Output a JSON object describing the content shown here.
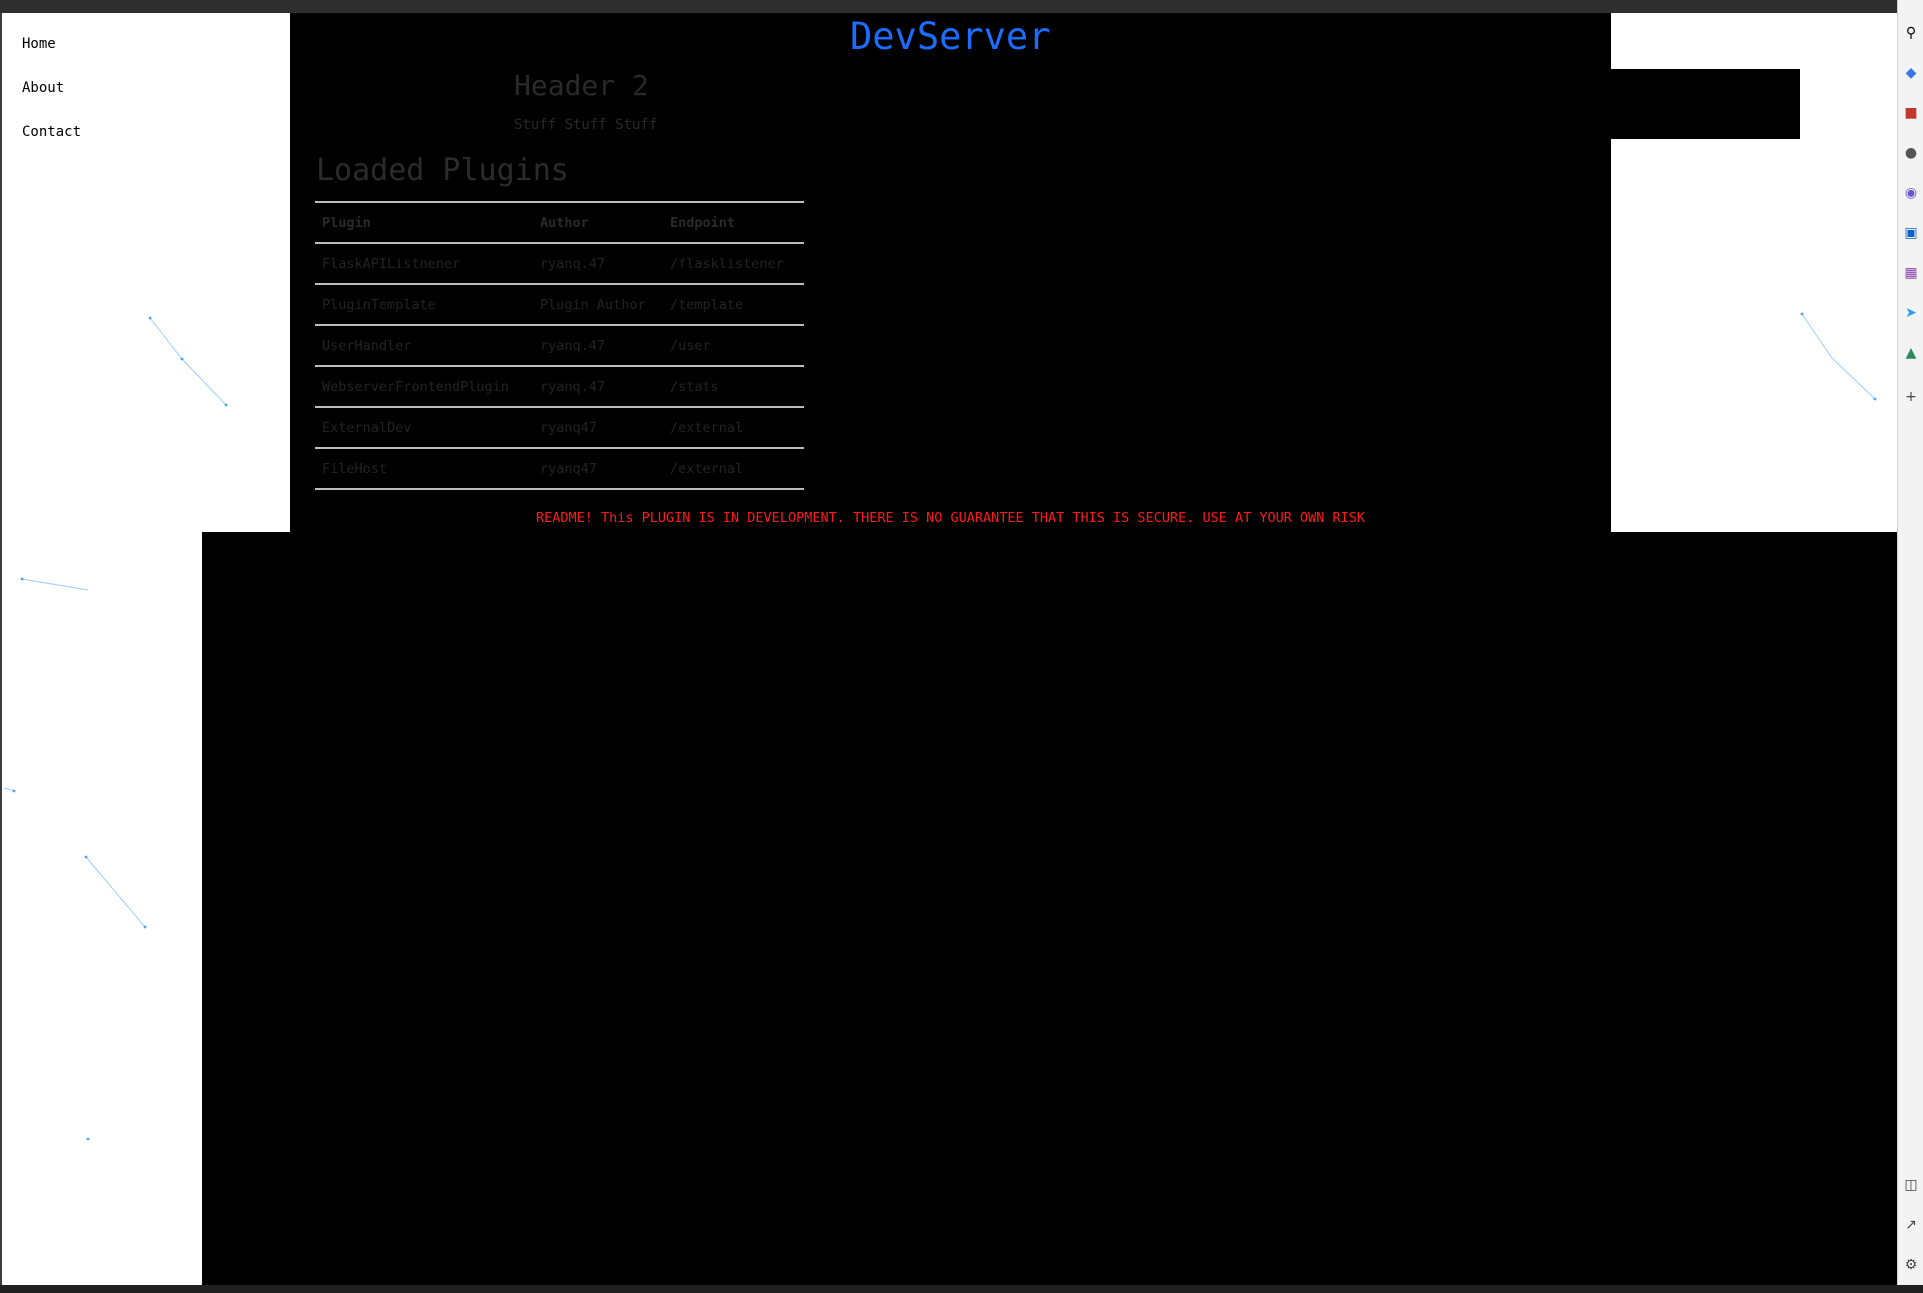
{
  "site": {
    "title": "DevServer",
    "title_color": "#1a6dff",
    "readme_color": "#ff1a1a",
    "particle_color": "#1e90ff"
  },
  "nav": {
    "items": [
      {
        "label": "Home"
      },
      {
        "label": "About"
      },
      {
        "label": "Contact"
      }
    ]
  },
  "content": {
    "header2": "Header 2",
    "subtext": "Stuff Stuff Stuff",
    "plugins_heading": "Loaded Plugins",
    "table": {
      "headers": [
        "Plugin",
        "Author",
        "Endpoint"
      ],
      "rows": [
        [
          "FlaskAPIListnener",
          "ryanq.47",
          "/flasklistener"
        ],
        [
          "PluginTemplate",
          "Plugin Author",
          "/template"
        ],
        [
          "UserHandler",
          "ryanq.47",
          "/user"
        ],
        [
          "WebserverFrontendPlugin",
          "ryanq.47",
          "/stats"
        ],
        [
          "ExternalDev",
          "ryanq47",
          "/external"
        ],
        [
          "FileHost",
          "ryanq47",
          "/external"
        ]
      ]
    },
    "readme": "README! This PLUGIN IS IN DEVELOPMENT. THERE IS NO GUARANTEE THAT THIS IS SECURE. USE AT YOUR OWN RISK"
  },
  "browser_sidebar": {
    "icons": [
      "search-icon",
      "tag-icon",
      "briefcase-icon",
      "person-icon",
      "copilot-icon",
      "outlook-icon",
      "image-icon",
      "send-icon",
      "tree-icon",
      "add-icon",
      "split-screen-icon",
      "external-link-icon",
      "settings-icon"
    ]
  }
}
